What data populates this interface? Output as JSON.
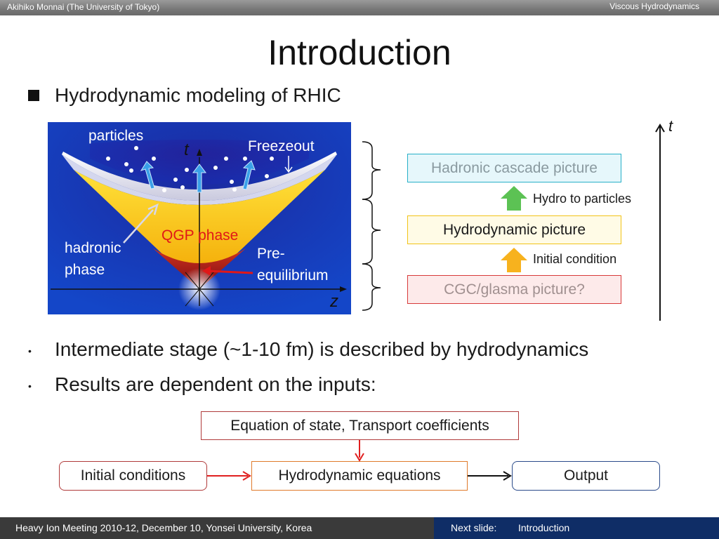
{
  "header": {
    "left_text": "Akihiko Monnai (The University of Tokyo)",
    "right_text": "Viscous Hydrodynamics"
  },
  "slide": {
    "title": "Introduction",
    "bullet_heading": "Hydrodynamic modeling of RHIC"
  },
  "diagram": {
    "label_particles": "particles",
    "label_t": "t",
    "label_freezeout": "Freezeout",
    "label_qgp": "QGP phase",
    "label_hadronic_1": "hadronic",
    "label_hadronic_2": "phase",
    "label_pre_1": "Pre-",
    "label_pre_2": "equilibrium",
    "label_z": "z"
  },
  "stages": {
    "hadronic": "Hadronic cascade picture",
    "hydro_to_particles": "Hydro to particles",
    "hydro": "Hydrodynamic picture",
    "initial_condition": "Initial condition",
    "cgc": "CGC/glasma picture?",
    "time_label": "t",
    "colors": {
      "hadronic_border": "#27b0c8",
      "hadronic_bg": "#e6f7fb",
      "hydro_border": "#f2c318",
      "hydro_bg": "#fffbe6",
      "cgc_border": "#d83a3a",
      "cgc_bg": "#fdeaea",
      "green_arrow": "#5cc254",
      "orange_arrow": "#f7b21e"
    }
  },
  "bullets": [
    "Intermediate stage (~1-10 fm) is described by hydrodynamics",
    "Results are dependent on the inputs:"
  ],
  "flow": {
    "eos": "Equation of state, Transport coefficients",
    "initial": "Initial conditions",
    "hydro_eq": "Hydrodynamic equations",
    "output": "Output"
  },
  "footer": {
    "meeting": "Heavy Ion Meeting 2010-12, December 10, Yonsei University, Korea",
    "next_label": "Next slide:",
    "next_title": "Introduction"
  }
}
